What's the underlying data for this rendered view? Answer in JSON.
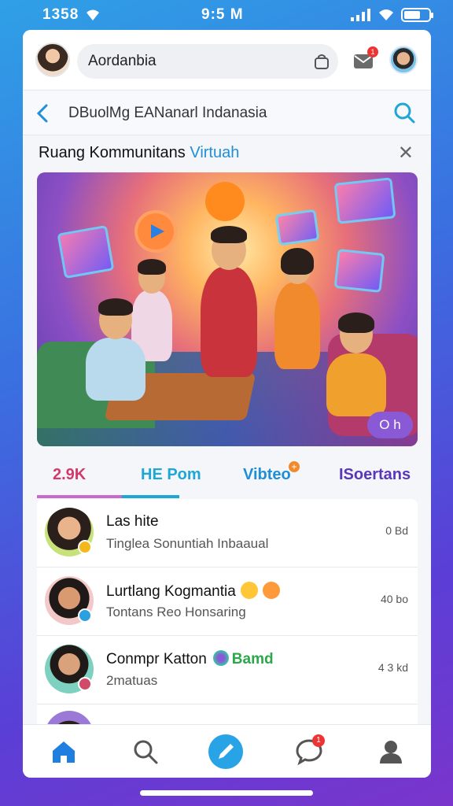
{
  "status": {
    "time_left": "1358",
    "time_center": "9:5 M",
    "battery_level_fraction": 0.6
  },
  "topbar": {
    "search_text": "Aordanbia",
    "mail_badge": "1"
  },
  "subbar": {
    "title": "DBuolMg EANanarl Indanasia"
  },
  "room": {
    "title_main": "Ruang Kommunitans",
    "title_accent": "Virtuah",
    "badge": "O h"
  },
  "tabs": [
    {
      "label": "2.9K"
    },
    {
      "label": "HE Pom"
    },
    {
      "label": "Vibteo"
    },
    {
      "label": "ISoertans"
    }
  ],
  "tab_plus": "+",
  "list": [
    {
      "title": "Las hite",
      "subtitle": "Tinglea Sonuntiah Inbaaual",
      "time": "0 Bd"
    },
    {
      "title": "Lurtlang Kogmantia",
      "subtitle": "Tontans Reo Honsaring",
      "time": "40 bo"
    },
    {
      "title": "Conmpr Katton",
      "tag": "Bamd",
      "subtitle": "2matuas",
      "time": "4 3 kd"
    }
  ],
  "nav": {
    "chat_badge": "1"
  },
  "colors": {
    "accent_blue": "#1f8fd6",
    "tab_pink": "#d23a6b",
    "tab_purple": "#5a36b8",
    "badge_red": "#e33"
  }
}
